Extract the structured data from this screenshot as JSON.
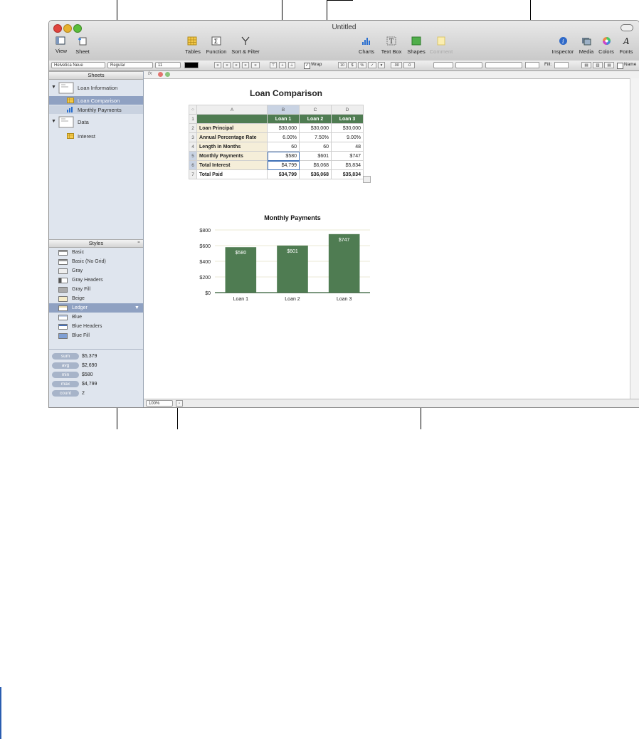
{
  "window": {
    "title": "Untitled"
  },
  "toolbar": {
    "view": "View",
    "sheet": "Sheet",
    "tables": "Tables",
    "function": "Function",
    "sort_filter": "Sort & Filter",
    "charts": "Charts",
    "text_box": "Text Box",
    "shapes": "Shapes",
    "comment": "Comment",
    "inspector": "Inspector",
    "media": "Media",
    "colors": "Colors",
    "fonts": "Fonts"
  },
  "format_bar": {
    "font": "Helvetica Neue",
    "typeface": "Regular",
    "size": "11",
    "wrap": "Wrap",
    "fill": "Fill:",
    "name": "Name"
  },
  "sheets": {
    "header": "Sheets",
    "items": [
      {
        "label": "Loan Information"
      },
      {
        "label": "Loan Comparison"
      },
      {
        "label": "Monthly Payments"
      },
      {
        "label": "Data"
      },
      {
        "label": "Interest"
      }
    ]
  },
  "styles": {
    "header": "Styles",
    "items": [
      "Basic",
      "Basic (No Grid)",
      "Gray",
      "Gray Headers",
      "Gray Fill",
      "Beige",
      "Ledger",
      "Blue",
      "Blue Headers",
      "Blue Fill"
    ],
    "selected": "Ledger"
  },
  "calculations": [
    {
      "label": "sum",
      "value": "$5,379"
    },
    {
      "label": "avg",
      "value": "$2,690"
    },
    {
      "label": "min",
      "value": "$580"
    },
    {
      "label": "max",
      "value": "$4,799"
    },
    {
      "label": "count",
      "value": "2"
    }
  ],
  "zoom": "100%",
  "table": {
    "title": "Loan Comparison",
    "columns": [
      "A",
      "B",
      "C",
      "D"
    ],
    "rows": [
      {
        "n": "1",
        "label": "",
        "values": [
          "Loan 1",
          "Loan 2",
          "Loan 3"
        ]
      },
      {
        "n": "2",
        "label": "Loan Principal",
        "values": [
          "$30,000",
          "$30,000",
          "$30,000"
        ]
      },
      {
        "n": "3",
        "label": "Annual Percentage Rate",
        "values": [
          "6.00%",
          "7.50%",
          "9.00%"
        ]
      },
      {
        "n": "4",
        "label": "Length in Months",
        "values": [
          "60",
          "60",
          "48"
        ]
      },
      {
        "n": "5",
        "label": "Monthly Payments",
        "values": [
          "$580",
          "$601",
          "$747"
        ]
      },
      {
        "n": "6",
        "label": "Total Interest",
        "values": [
          "$4,799",
          "$6,068",
          "$5,834"
        ]
      },
      {
        "n": "7",
        "label": "Total Paid",
        "values": [
          "$34,799",
          "$36,068",
          "$35,834"
        ]
      }
    ]
  },
  "chart_data": {
    "type": "bar",
    "title": "Monthly Payments",
    "categories": [
      "Loan 1",
      "Loan 2",
      "Loan 3"
    ],
    "values": [
      580,
      601,
      747
    ],
    "value_labels": [
      "$580",
      "$601",
      "$747"
    ],
    "y_ticks": [
      "$0",
      "$200",
      "$400",
      "$600",
      "$800"
    ],
    "ylim": [
      0,
      800
    ],
    "bar_color": "#4f7c52",
    "grid": true,
    "xlabel": "",
    "ylabel": ""
  }
}
